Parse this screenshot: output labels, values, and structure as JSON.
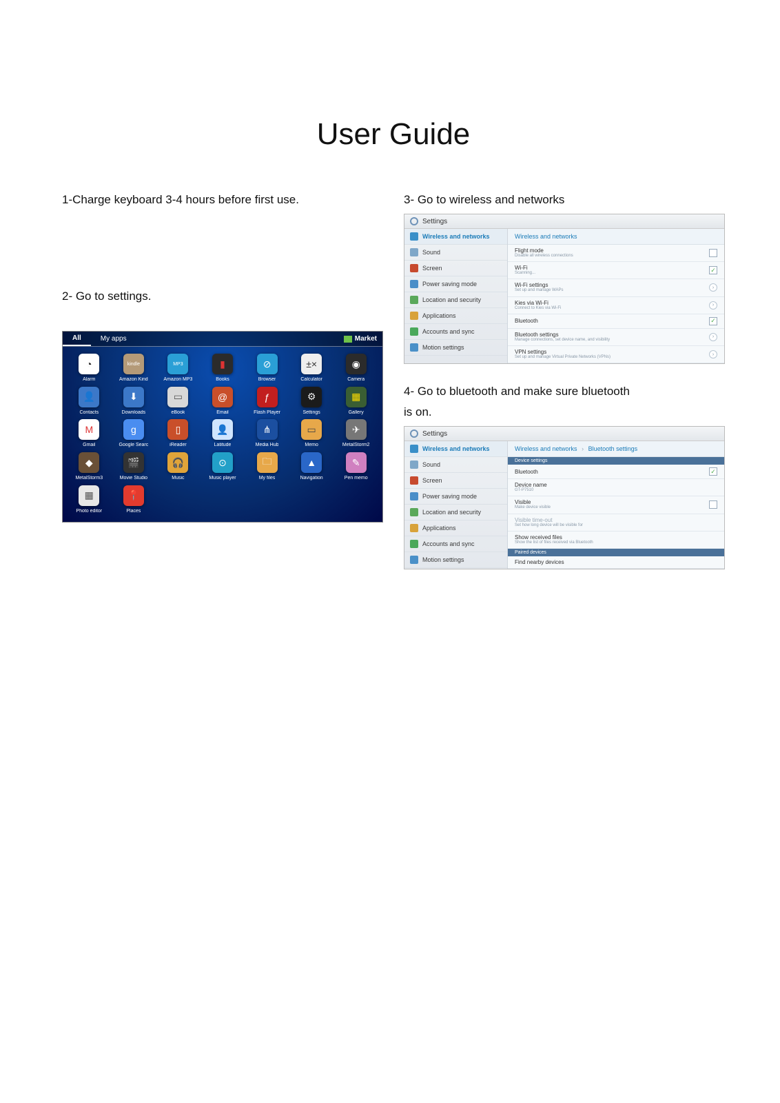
{
  "title": "User Guide",
  "steps": {
    "s1": "1-Charge keyboard 3-4 hours before first use.",
    "s2": "2- Go to settings.",
    "s3": "3- Go to wireless and networks",
    "s4a": "4- Go to bluetooth and make sure bluetooth",
    "s4b": "is on."
  },
  "drawer": {
    "tabs": {
      "all": "All",
      "myapps": "My apps",
      "market": "Market"
    },
    "apps": [
      {
        "label": "Alarm",
        "bg": "#ffffff",
        "fg": "#222",
        "glyph": "◔"
      },
      {
        "label": "Amazon Kind",
        "bg": "#b49a78",
        "fg": "#fff",
        "glyph": "kindle"
      },
      {
        "label": "Amazon MP3",
        "bg": "#2a9fd6",
        "fg": "#fff",
        "glyph": "MP3"
      },
      {
        "label": "Books",
        "bg": "#2b2b2b",
        "fg": "#d33",
        "glyph": "▮"
      },
      {
        "label": "Browser",
        "bg": "#2a9fd6",
        "fg": "#fff",
        "glyph": "⊘"
      },
      {
        "label": "Calculator",
        "bg": "#eeeeee",
        "fg": "#333",
        "glyph": "±×"
      },
      {
        "label": "Camera",
        "bg": "#2b2b2b",
        "fg": "#fff",
        "glyph": "◉"
      },
      {
        "label": "Contacts",
        "bg": "#3c78c8",
        "fg": "#fff",
        "glyph": "👤"
      },
      {
        "label": "Downloads",
        "bg": "#3c78c8",
        "fg": "#fff",
        "glyph": "⬇"
      },
      {
        "label": "eBook",
        "bg": "#d8d8d8",
        "fg": "#555",
        "glyph": "▭"
      },
      {
        "label": "Email",
        "bg": "#c94f2a",
        "fg": "#fff",
        "glyph": "@"
      },
      {
        "label": "Flash Player",
        "bg": "#c21f1f",
        "fg": "#fff",
        "glyph": "ƒ"
      },
      {
        "label": "Settings",
        "bg": "#1b1b1b",
        "fg": "#eee",
        "glyph": "⚙"
      },
      {
        "label": "Gallery",
        "bg": "#3a5e33",
        "fg": "#fd0",
        "glyph": "▦"
      },
      {
        "label": "Gmail",
        "bg": "#ffffff",
        "fg": "#d33",
        "glyph": "M"
      },
      {
        "label": "Google Searc",
        "bg": "#4a8df0",
        "fg": "#fff",
        "glyph": "g"
      },
      {
        "label": "iReader",
        "bg": "#c94f2a",
        "fg": "#fff",
        "glyph": "▯"
      },
      {
        "label": "Latitude",
        "bg": "#cfe5ff",
        "fg": "#3c78c8",
        "glyph": "👤"
      },
      {
        "label": "Media Hub",
        "bg": "#1b4fa0",
        "fg": "#fff",
        "glyph": "⋔"
      },
      {
        "label": "Memo",
        "bg": "#e7a84a",
        "fg": "#444",
        "glyph": "▭"
      },
      {
        "label": "MetalStorm2",
        "bg": "#777777",
        "fg": "#fff",
        "glyph": "✈"
      },
      {
        "label": "MetalStorm3",
        "bg": "#6a5037",
        "fg": "#fff",
        "glyph": "◆"
      },
      {
        "label": "Movie Studio",
        "bg": "#333333",
        "fg": "#fff",
        "glyph": "🎬"
      },
      {
        "label": "Music",
        "bg": "#e0a43a",
        "fg": "#fff",
        "glyph": "🎧"
      },
      {
        "label": "Music player",
        "bg": "#22a0c8",
        "fg": "#fff",
        "glyph": "⊙"
      },
      {
        "label": "My files",
        "bg": "#e7a84a",
        "fg": "#fff",
        "glyph": "🗀"
      },
      {
        "label": "Navigation",
        "bg": "#2a67c8",
        "fg": "#fff",
        "glyph": "▲"
      },
      {
        "label": "Pen memo",
        "bg": "#d080c0",
        "fg": "#fff",
        "glyph": "✎"
      },
      {
        "label": "Photo editor",
        "bg": "#e8e8e8",
        "fg": "#555",
        "glyph": "▦"
      },
      {
        "label": "Places",
        "bg": "#e33b2e",
        "fg": "#fff",
        "glyph": "📍"
      }
    ]
  },
  "settingsLabel": "Settings",
  "sidebar": [
    {
      "label": "Wireless and networks",
      "color": "#3a8fc8"
    },
    {
      "label": "Sound",
      "color": "#7fa7c8"
    },
    {
      "label": "Screen",
      "color": "#c74a2e"
    },
    {
      "label": "Power saving mode",
      "color": "#4a8ec8"
    },
    {
      "label": "Location and security",
      "color": "#5aa85a"
    },
    {
      "label": "Applications",
      "color": "#d8a23a"
    },
    {
      "label": "Accounts and sync",
      "color": "#4aa85a"
    },
    {
      "label": "Motion settings",
      "color": "#4a90c8"
    }
  ],
  "screen3": {
    "header": "Wireless and networks",
    "rows": [
      {
        "title": "Flight mode",
        "sub": "Disable all wireless connections",
        "right": "ck-empty"
      },
      {
        "title": "Wi-Fi",
        "sub": "Scanning...",
        "right": "ck-on"
      },
      {
        "title": "Wi-Fi settings",
        "sub": "Set up and manage WAPs",
        "right": "arrow"
      },
      {
        "title": "Kies via Wi-Fi",
        "sub": "Connect to Kies via Wi-Fi",
        "right": "arrow"
      },
      {
        "title": "Bluetooth",
        "sub": "",
        "right": "ck-on"
      },
      {
        "title": "Bluetooth settings",
        "sub": "Manage connections, set device name, and visibility",
        "right": "arrow"
      },
      {
        "title": "VPN settings",
        "sub": "Set up and manage Virtual Private Networks (VPNs)",
        "right": "arrow"
      }
    ]
  },
  "screen4": {
    "crumb1": "Wireless and networks",
    "crumb2": "Bluetooth settings",
    "sections": {
      "device": "Device settings",
      "paired": "Paired devices"
    },
    "rows": {
      "bluetooth": {
        "title": "Bluetooth",
        "sub": ""
      },
      "devname": {
        "title": "Device name",
        "sub": "GT-P7510"
      },
      "visible": {
        "title": "Visible",
        "sub": "Make device visible"
      },
      "timeout": {
        "title": "Visible time-out",
        "sub": "Set how long device will be visible for"
      },
      "received": {
        "title": "Show received files",
        "sub": "Show the list of files received via Bluetooth"
      },
      "find": {
        "title": "Find nearby devices",
        "sub": ""
      }
    }
  }
}
